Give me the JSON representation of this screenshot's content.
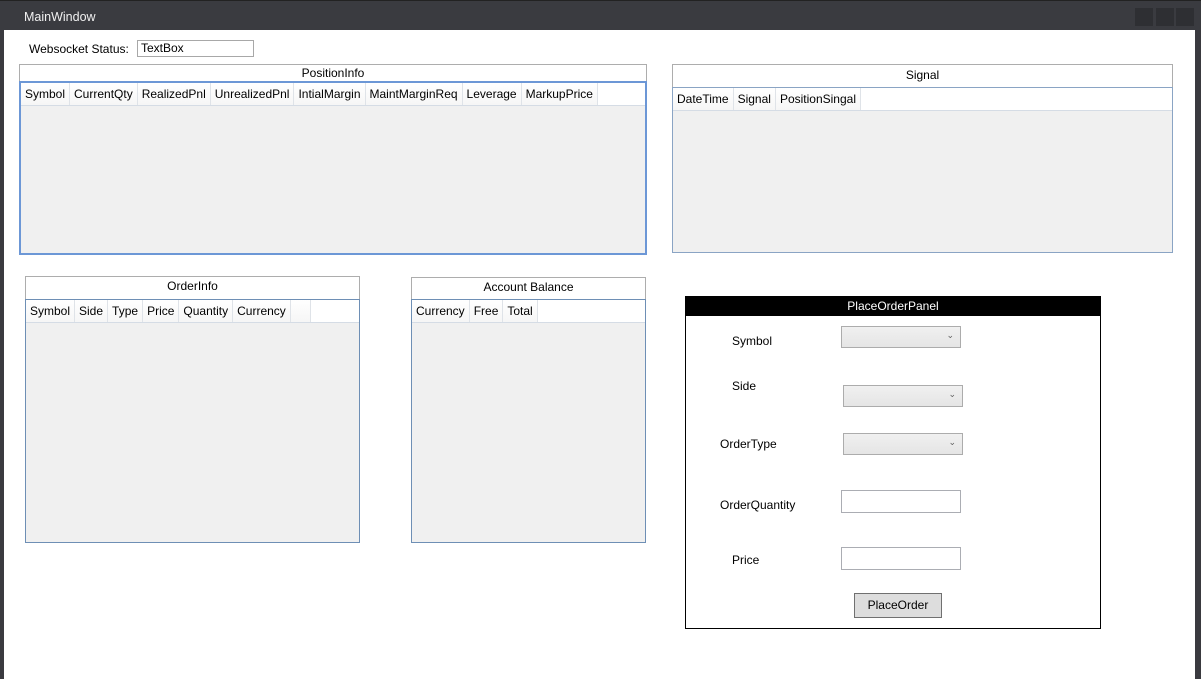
{
  "window": {
    "title": "MainWindow",
    "controls": [
      "minimize",
      "maximize",
      "close"
    ]
  },
  "websocket": {
    "label": "Websocket Status:",
    "value": "TextBox"
  },
  "position_info": {
    "title": "PositionInfo",
    "columns": [
      "Symbol",
      "CurrentQty",
      "RealizedPnl",
      "UnrealizedPnl",
      "IntialMargin",
      "MaintMarginReq",
      "Leverage",
      "MarkupPrice"
    ],
    "rows": []
  },
  "signal": {
    "title": "Signal",
    "columns": [
      "DateTime",
      "Signal",
      "PositionSingal"
    ],
    "rows": []
  },
  "order_info": {
    "title": "OrderInfo",
    "columns": [
      "Symbol",
      "Side",
      "Type",
      "Price",
      "Quantity",
      "Currency",
      ""
    ],
    "rows": []
  },
  "account_balance": {
    "title": "Account Balance",
    "columns": [
      "Currency",
      "Free",
      "Total"
    ],
    "rows": []
  },
  "place_order_panel": {
    "title": "PlaceOrderPanel",
    "symbol_label": "Symbol",
    "symbol_value": "",
    "side_label": "Side",
    "side_value": "",
    "order_type_label": "OrderType",
    "order_type_value": "",
    "order_quantity_label": "OrderQuantity",
    "order_quantity_value": "",
    "price_label": "Price",
    "price_value": "",
    "button_label": "PlaceOrder"
  },
  "icons": {
    "chevron": "⌄"
  }
}
